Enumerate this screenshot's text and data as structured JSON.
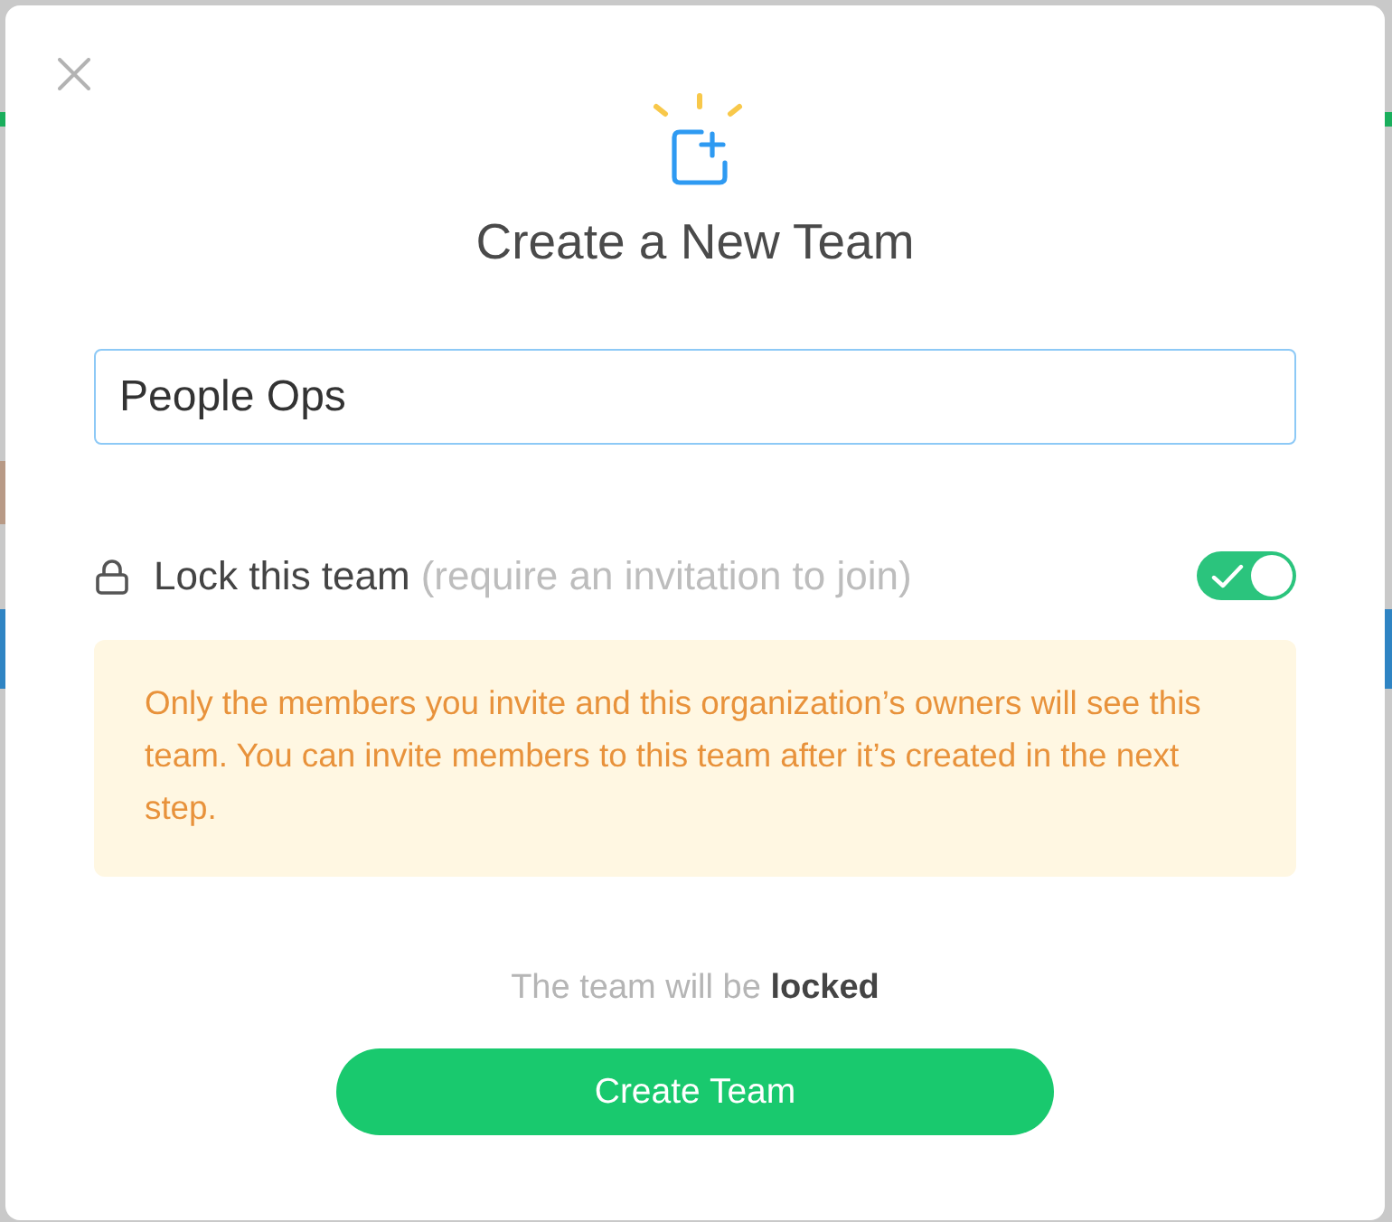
{
  "dialog": {
    "title": "Create a New Team",
    "team_name": {
      "value": "People Ops"
    },
    "lock": {
      "label": "Lock this team",
      "hint": "(require an invitation to join)",
      "on": true
    },
    "notice": "Only the members you invite and this organization’s owners will see this team. You can invite members to this team after it’s created in the next step.",
    "status": "The team will be **locked**",
    "submit_button": "Create Team"
  }
}
